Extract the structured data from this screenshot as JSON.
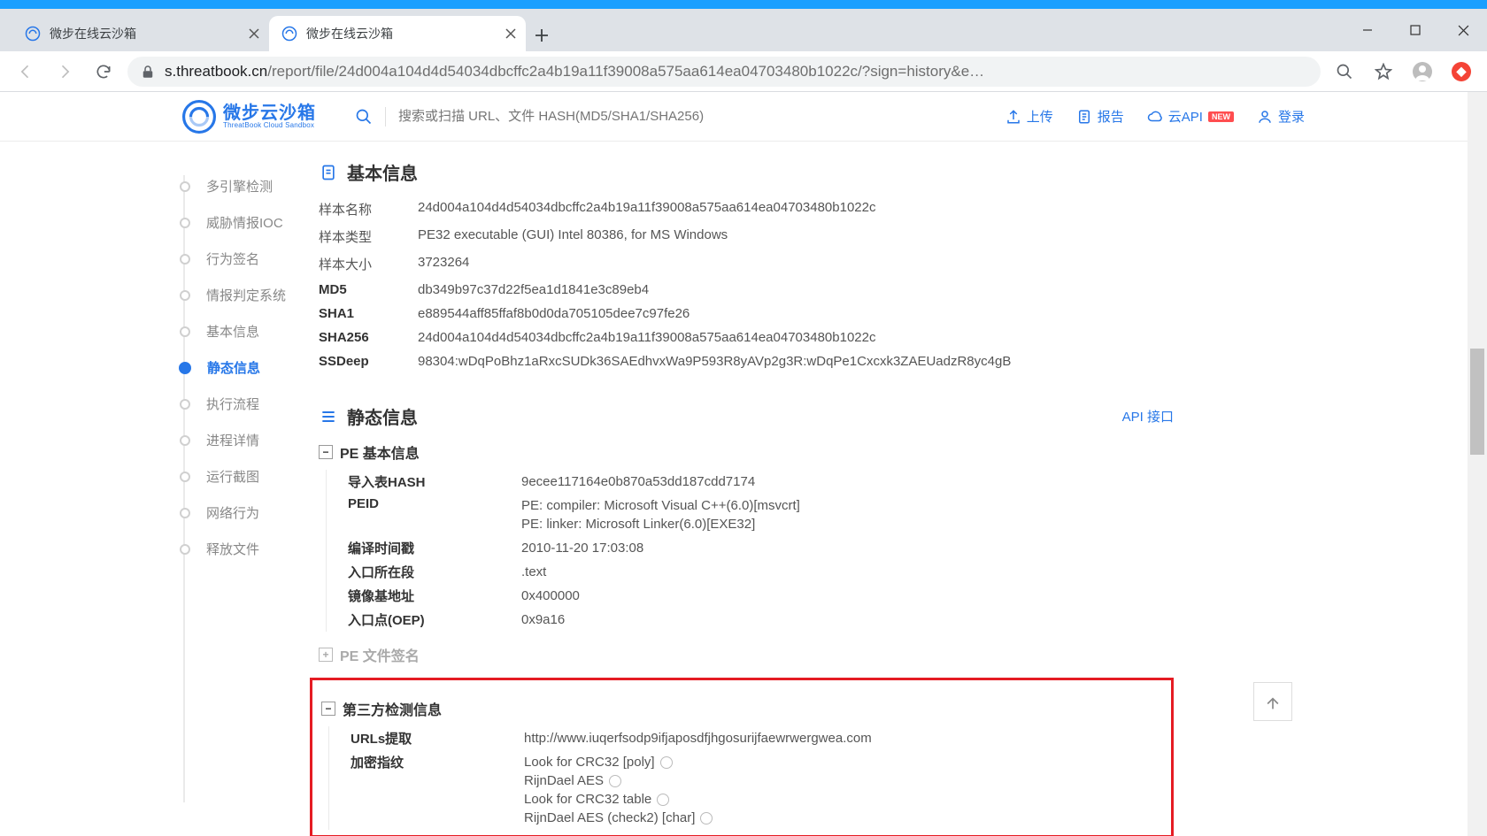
{
  "browser": {
    "tabs": [
      {
        "title": "微步在线云沙箱",
        "active": false
      },
      {
        "title": "微步在线云沙箱",
        "active": true
      }
    ],
    "url_domain": "s.threatbook.cn",
    "url_path": "/report/file/24d004a104d4d54034dbcffc2a4b19a11f39008a575aa614ea04703480b1022c/?sign=history&e…"
  },
  "logo": {
    "cn": "微步云沙箱",
    "en": "ThreatBook Cloud Sandbox"
  },
  "search_placeholder": "搜索或扫描 URL、文件 HASH(MD5/SHA1/SHA256)",
  "header_actions": {
    "upload": "上传",
    "report": "报告",
    "cloud_api": "云API",
    "new_badge": "NEW",
    "login": "登录"
  },
  "sidenav": {
    "items": [
      {
        "label": "多引擎检测"
      },
      {
        "label": "威胁情报IOC"
      },
      {
        "label": "行为签名"
      },
      {
        "label": "情报判定系统"
      },
      {
        "label": "基本信息"
      },
      {
        "label": "静态信息"
      },
      {
        "label": "执行流程"
      },
      {
        "label": "进程详情"
      },
      {
        "label": "运行截图"
      },
      {
        "label": "网络行为"
      },
      {
        "label": "释放文件"
      }
    ],
    "active_index": 5
  },
  "sections": {
    "basic_title": "基本信息",
    "static_title": "静态信息",
    "api_link": "API 接口",
    "basic_rows": [
      {
        "k": "样本名称",
        "v": "24d004a104d4d54034dbcffc2a4b19a11f39008a575aa614ea04703480b1022c",
        "bold": false
      },
      {
        "k": "样本类型",
        "v": "PE32 executable (GUI) Intel 80386, for MS Windows",
        "bold": false
      },
      {
        "k": "样本大小",
        "v": "3723264",
        "bold": false
      },
      {
        "k": "MD5",
        "v": "db349b97c37d22f5ea1d1841e3c89eb4",
        "bold": true
      },
      {
        "k": "SHA1",
        "v": "e889544aff85ffaf8b0d0da705105dee7c97fe26",
        "bold": true
      },
      {
        "k": "SHA256",
        "v": "24d004a104d4d54034dbcffc2a4b19a11f39008a575aa614ea04703480b1022c",
        "bold": true
      },
      {
        "k": "SSDeep",
        "v": "98304:wDqPoBhz1aRxcSUDk36SAEdhvxWa9P593R8yAVp2g3R:wDqPe1Cxcxk3ZAEUadzR8yc4gB",
        "bold": true
      }
    ],
    "pe_basic_title": "PE 基本信息",
    "pe_sig_title": "PE 文件签名",
    "pe_basic_rows": [
      {
        "k": "导入表HASH",
        "v": [
          "9ecee117164e0b870a53dd187cdd7174"
        ]
      },
      {
        "k": "PEID",
        "v": [
          "PE: compiler: Microsoft Visual C++(6.0)[msvcrt]",
          "PE: linker: Microsoft Linker(6.0)[EXE32]"
        ]
      },
      {
        "k": "编译时间戳",
        "v": [
          "2010-11-20 17:03:08"
        ]
      },
      {
        "k": "入口所在段",
        "v": [
          ".text"
        ]
      },
      {
        "k": "镜像基地址",
        "v": [
          "0x400000"
        ]
      },
      {
        "k": "入口点(OEP)",
        "v": [
          "0x9a16"
        ]
      }
    ],
    "thirdparty_title": "第三方检测信息",
    "thirdparty_rows": [
      {
        "k": "URLs提取",
        "v": [
          "http://www.iuqerfsodp9ifjaposdfjhgosurijfaewrwergwea.com"
        ],
        "info": [
          false
        ]
      },
      {
        "k": "加密指纹",
        "v": [
          "Look for CRC32 [poly]",
          "RijnDael AES",
          "Look for CRC32 table",
          "RijnDael AES (check2) [char]"
        ],
        "info": [
          true,
          true,
          true,
          true
        ]
      }
    ]
  }
}
